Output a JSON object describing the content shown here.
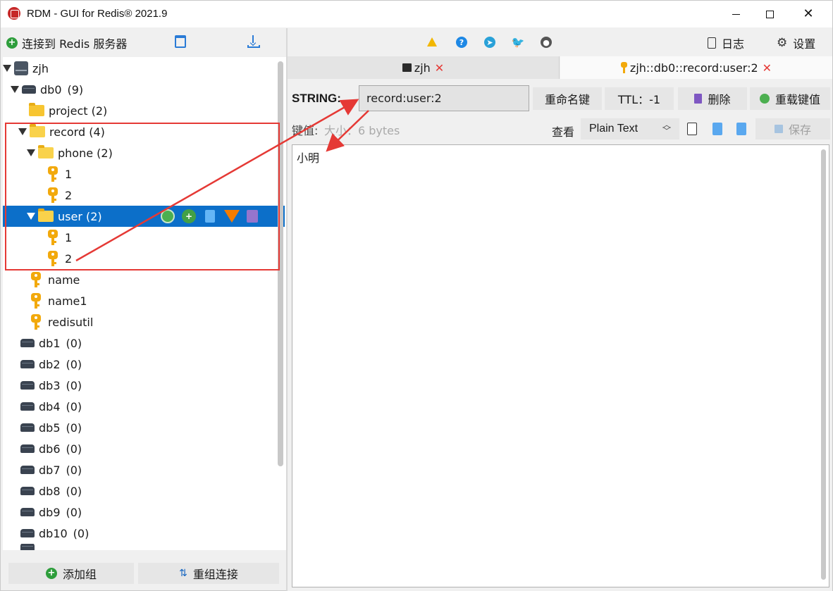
{
  "window": {
    "title": "RDM - GUI for Redis® 2021.9",
    "close_glyph": "✕"
  },
  "left_toolbar": {
    "connect_label": "连接到 Redis 服务器",
    "connect_icon": "plus-circle-icon",
    "import_icon": "import-icon",
    "export_icon": "export-icon"
  },
  "tree": {
    "server": "zjh",
    "db0": {
      "label": "db0",
      "count": "(9)"
    },
    "nodes": [
      {
        "type": "folder",
        "label": "project (2)"
      },
      {
        "type": "folder-open",
        "label": "record (4)"
      },
      {
        "type": "folder-open",
        "label": "phone (2)"
      },
      {
        "type": "key",
        "label": "1"
      },
      {
        "type": "key",
        "label": "2"
      },
      {
        "type": "folder-open",
        "label": "user (2)"
      },
      {
        "type": "key",
        "label": "1"
      },
      {
        "type": "key",
        "label": "2"
      },
      {
        "type": "key",
        "label": "name"
      },
      {
        "type": "key",
        "label": "name1"
      },
      {
        "type": "key",
        "label": "redisutil"
      }
    ],
    "databases": [
      {
        "label": "db1",
        "count": "(0)"
      },
      {
        "label": "db2",
        "count": "(0)"
      },
      {
        "label": "db3",
        "count": "(0)"
      },
      {
        "label": "db4",
        "count": "(0)"
      },
      {
        "label": "db5",
        "count": "(0)"
      },
      {
        "label": "db6",
        "count": "(0)"
      },
      {
        "label": "db7",
        "count": "(0)"
      },
      {
        "label": "db8",
        "count": "(0)"
      },
      {
        "label": "db9",
        "count": "(0)"
      },
      {
        "label": "db10",
        "count": "(0)"
      }
    ],
    "row_actions": [
      "reload-icon",
      "add-icon",
      "copy-icon",
      "filter-icon",
      "delete-icon"
    ],
    "add_symbol": "+"
  },
  "left_bottom": {
    "add_group": "添加组",
    "reconnect": "重组连接",
    "reconnect_glyph": "⇅"
  },
  "header": {
    "icons": [
      "warning-icon",
      "help-icon",
      "telegram-icon",
      "twitter-icon",
      "github-icon"
    ],
    "help_glyph": "?",
    "telegram_glyph": "➤",
    "twitter_glyph": "🐦",
    "github_glyph": "●",
    "log_label": "日志",
    "settings_label": "设置",
    "gear_glyph": "⚙"
  },
  "tabs": [
    {
      "label": "zjh",
      "active": false
    },
    {
      "label": "zjh::db0::record:user:2",
      "active": true
    }
  ],
  "tab_close_glyph": "✕",
  "key_view": {
    "type_label": "STRING:",
    "key_name": "record:user:2",
    "rename_label": "重命名键",
    "ttl_label": "TTL：-1",
    "delete_label": "删除",
    "reload_label": "重载键值",
    "value_label": "键值:",
    "size_label": "大小：6 bytes",
    "view_label": "查看",
    "view_mode": "Plain Text",
    "view_chevron_up": "︿",
    "view_chevron_down": "﹀",
    "save_label": "保存",
    "value": "小明"
  },
  "colors": {
    "selected_row": "#0c6fc9",
    "annotation_red": "#e53935",
    "folder": "#f7c531",
    "key": "#f2a90c"
  }
}
